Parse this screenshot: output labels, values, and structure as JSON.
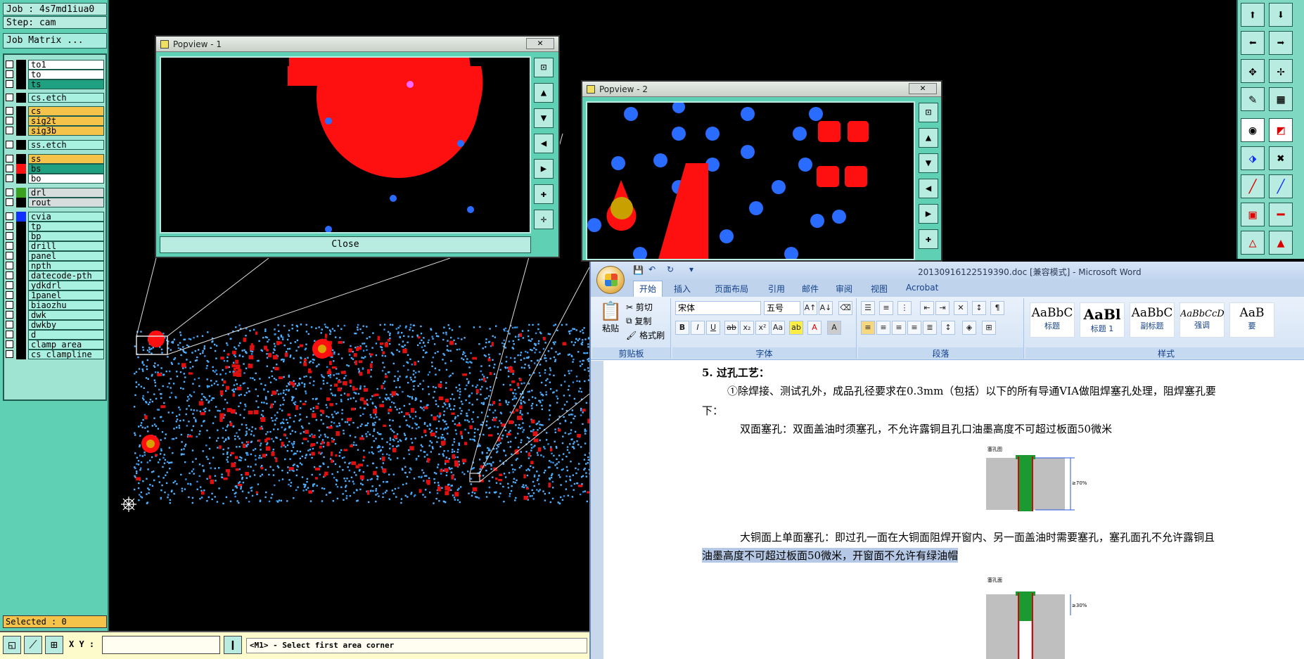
{
  "cam": {
    "job_label": "Job : 4s7md1iua0",
    "step_label": "Step: cam",
    "job_matrix_label": "Job Matrix ...",
    "layers": [
      {
        "name": "to1",
        "color": "#000000",
        "style": "white"
      },
      {
        "name": "to",
        "color": "#000000",
        "style": "white"
      },
      {
        "name": "ts",
        "color": "#000000",
        "style": "green"
      },
      {
        "name": "cs.etch",
        "color": "#000000",
        "style": "cyan"
      },
      {
        "name": "cs",
        "color": "#000000",
        "style": "orange"
      },
      {
        "name": "sig2t",
        "color": "#000000",
        "style": "orange"
      },
      {
        "name": "sig3b",
        "color": "#000000",
        "style": "orange"
      },
      {
        "name": "ss.etch",
        "color": "#000000",
        "style": "cyan"
      },
      {
        "name": "ss",
        "color": "#000000",
        "style": "orange"
      },
      {
        "name": "bs",
        "color": "#ff1010",
        "style": "green"
      },
      {
        "name": "bo",
        "color": "#000000",
        "style": "white"
      },
      {
        "name": "drl",
        "color": "#3ba020",
        "style": "grey"
      },
      {
        "name": "rout",
        "color": "#000000",
        "style": "grey"
      },
      {
        "name": "cvia",
        "color": "#1030ff",
        "style": "cyan"
      },
      {
        "name": "tp",
        "color": "#000000",
        "style": "cyan"
      },
      {
        "name": "bp",
        "color": "#000000",
        "style": "cyan"
      },
      {
        "name": "drill",
        "color": "#000000",
        "style": "cyan"
      },
      {
        "name": "panel",
        "color": "#000000",
        "style": "cyan"
      },
      {
        "name": "npth",
        "color": "#000000",
        "style": "cyan"
      },
      {
        "name": "datecode-pth",
        "color": "#000000",
        "style": "cyan"
      },
      {
        "name": "ydkdrl",
        "color": "#000000",
        "style": "cyan"
      },
      {
        "name": "1panel",
        "color": "#000000",
        "style": "cyan"
      },
      {
        "name": "biaozhu",
        "color": "#000000",
        "style": "cyan"
      },
      {
        "name": "dwk",
        "color": "#000000",
        "style": "cyan"
      },
      {
        "name": "dwkby",
        "color": "#000000",
        "style": "cyan"
      },
      {
        "name": "d",
        "color": "#000000",
        "style": "cyan"
      },
      {
        "name": "clamp_area",
        "color": "#000000",
        "style": "cyan"
      },
      {
        "name": "cs_clampline",
        "color": "#000000",
        "style": "cyan"
      }
    ],
    "selected_label": "Selected : 0",
    "xy_label": "X Y :",
    "xy_value": "",
    "status_message": "<M1> - Select first area corner",
    "popview1": {
      "title": "Popview - 1",
      "close_label": "Close"
    },
    "popview2": {
      "title": "Popview - 2"
    },
    "close_glyph": "✕"
  },
  "word": {
    "title": "20130916122519390.doc [兼容模式] - Microsoft Word",
    "tabs": [
      "开始",
      "插入",
      "页面布局",
      "引用",
      "邮件",
      "审阅",
      "视图",
      "Acrobat"
    ],
    "clipboard": {
      "paste": "粘贴",
      "cut": "剪切",
      "copy": "复制",
      "format_painter": "格式刷",
      "group": "剪贴板"
    },
    "font": {
      "name": "宋体",
      "size": "五号",
      "group": "字体"
    },
    "paragraph_group": "段落",
    "styles": {
      "group": "样式",
      "items": [
        {
          "sample": "AaBbC",
          "name": "标题"
        },
        {
          "sample": "AaBl",
          "name": "标题 1"
        },
        {
          "sample": "AaBbC",
          "name": "副标题"
        },
        {
          "sample": "AaBbCcD",
          "name": "强调"
        },
        {
          "sample": "AaB",
          "name": "要"
        }
      ]
    },
    "doc": {
      "heading": "5.  过孔工艺：",
      "p1": "①除焊接、测试孔外，成品孔径要求在0.3mm（包括）以下的所有导通VIA做阻焊塞孔处理，阻焊塞孔要",
      "p1_cont": "下：",
      "p2": "双面塞孔：双面盖油时须塞孔，不允许露铜且孔口油墨高度不可超过板面50微米",
      "fig1_label": "塞孔图",
      "fig1_pct": "≥70%",
      "p3": "大铜面上单面塞孔：即过孔一面在大铜面阻焊开窗内、另一面盖油时需要塞孔，塞孔面孔不允许露铜且",
      "p3_cont": "油墨高度不可超过板面50微米，开窗面不允许有绿油帽",
      "fig2_label": "塞孔面",
      "fig2_pct": "≥30%"
    }
  }
}
